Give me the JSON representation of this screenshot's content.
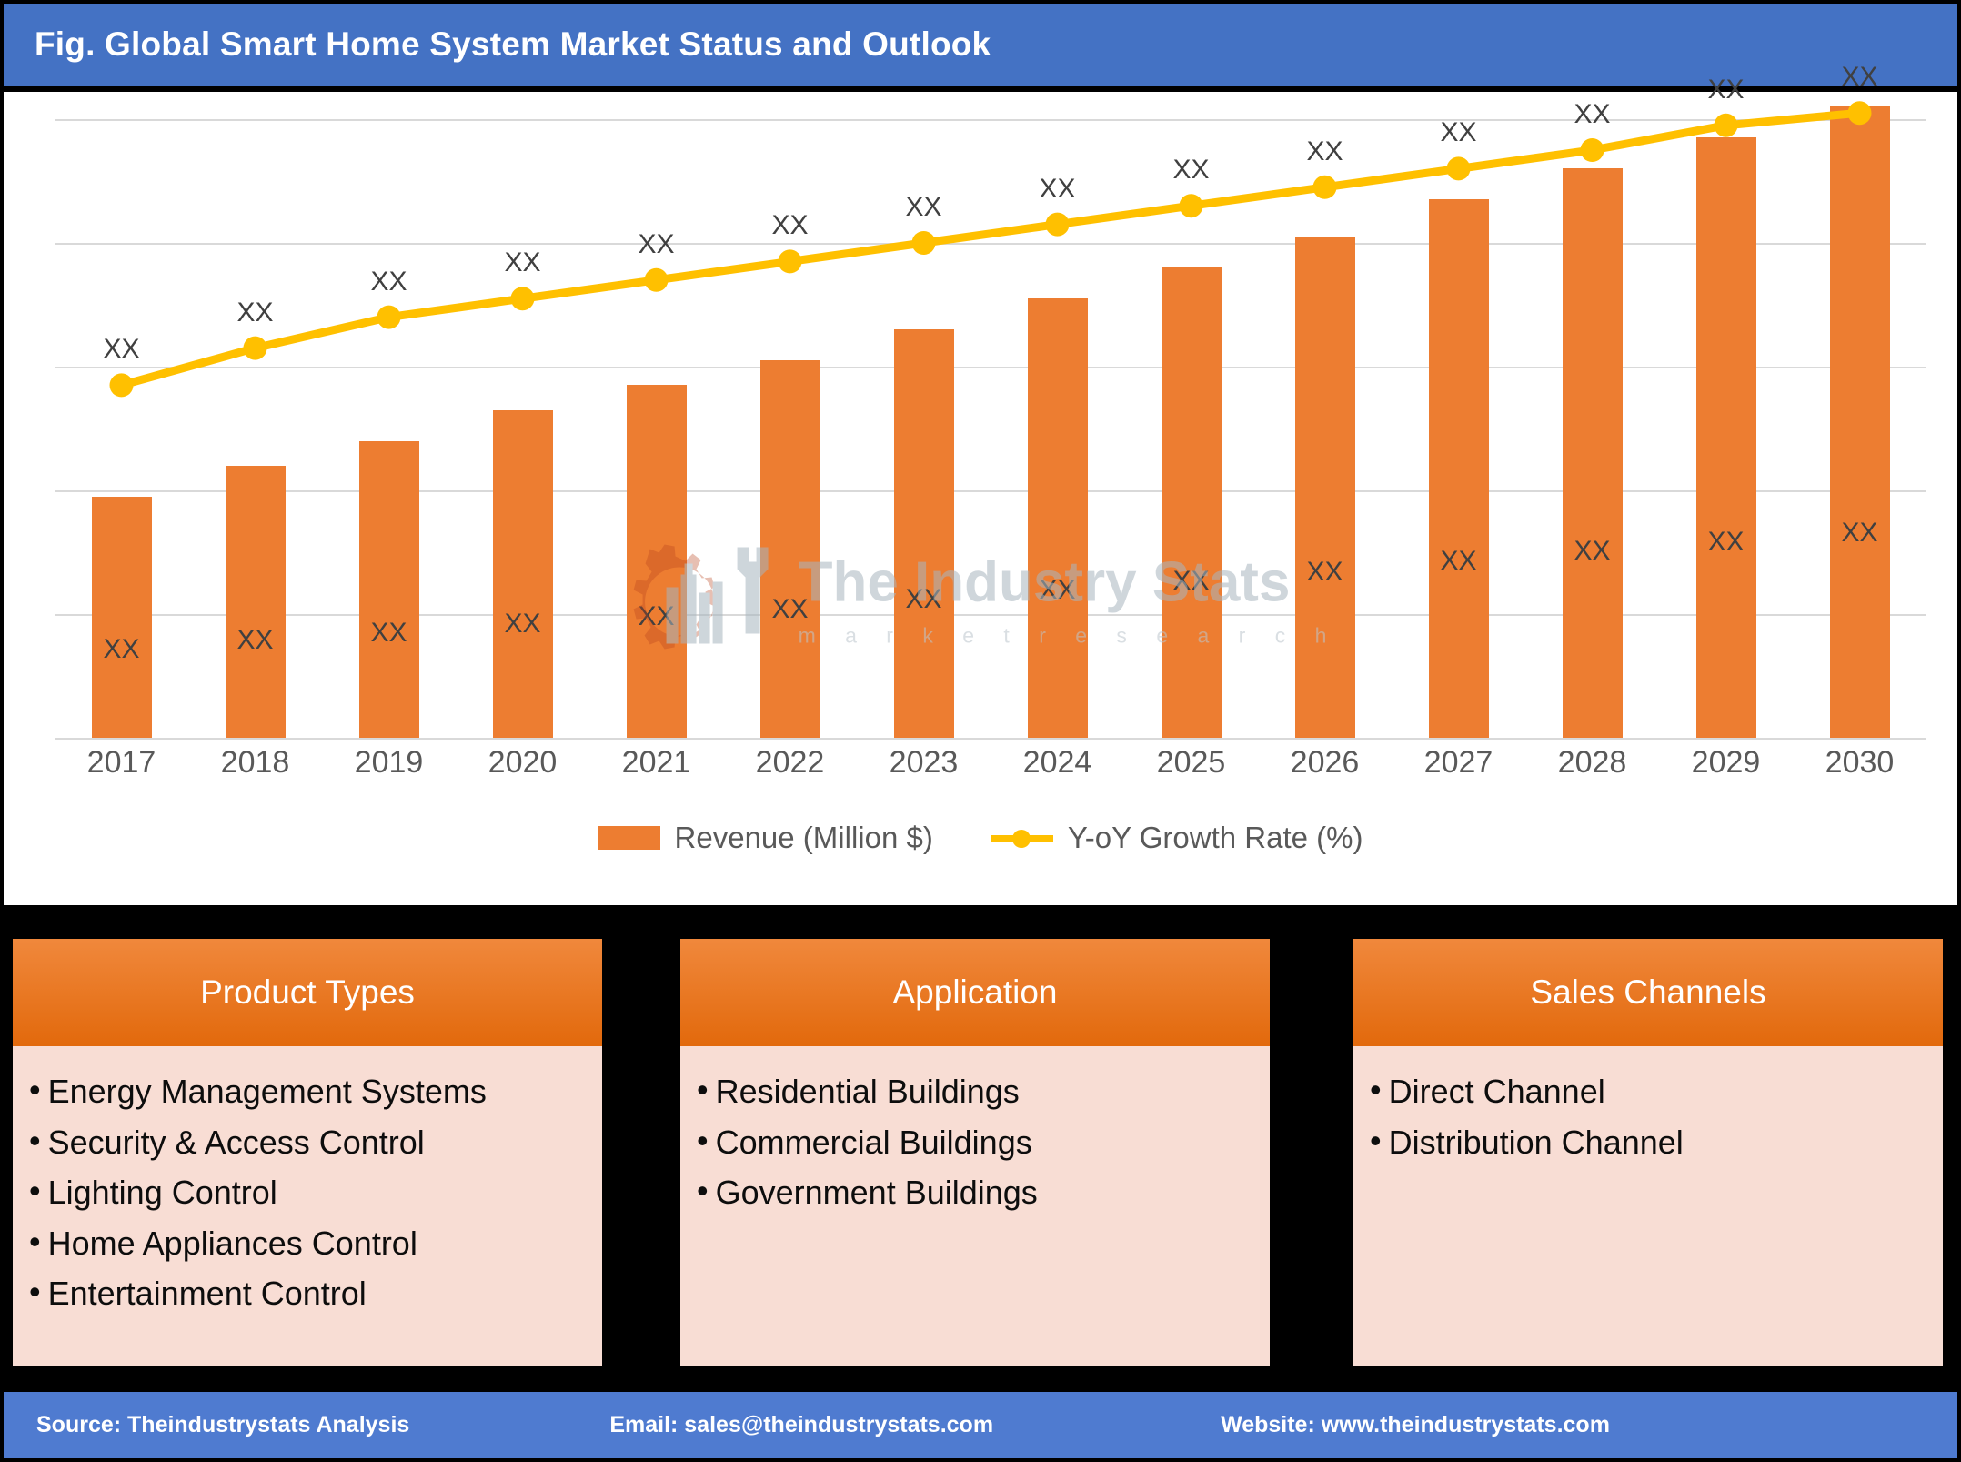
{
  "header": {
    "title": "Fig. Global Smart Home System Market Status and Outlook",
    "background_color": "#4472C4"
  },
  "watermark": {
    "main": "The Industry Stats",
    "sub": "m a r k e t   r e s e a r c h"
  },
  "legend": {
    "items": [
      {
        "label": "Revenue (Million $)",
        "color": "#ED7D31",
        "marker": "square"
      },
      {
        "label": "Y-oY Growth Rate (%)",
        "color": "#FFC000",
        "marker": "line-circle"
      }
    ]
  },
  "chart_data": {
    "type": "bar",
    "title": "Fig. Global Smart Home System Market Status and Outlook",
    "xlabel": "",
    "ylabel": "",
    "grid": true,
    "legend_position": "bottom",
    "categories": [
      "2017",
      "2018",
      "2019",
      "2020",
      "2021",
      "2022",
      "2023",
      "2024",
      "2025",
      "2026",
      "2027",
      "2028",
      "2029",
      "2030"
    ],
    "ylim": [
      0,
      100
    ],
    "series": [
      {
        "name": "Revenue (Million $)",
        "type": "bar",
        "color": "#ED7D31",
        "axis": "left",
        "values": [
          39,
          44,
          48,
          53,
          57,
          61,
          66,
          71,
          76,
          81,
          87,
          92,
          97,
          102
        ],
        "data_labels": [
          "XX",
          "XX",
          "XX",
          "XX",
          "XX",
          "XX",
          "XX",
          "XX",
          "XX",
          "XX",
          "XX",
          "XX",
          "XX",
          "XX"
        ]
      },
      {
        "name": "Y-oY Growth Rate (%)",
        "type": "line",
        "color": "#FFC000",
        "axis": "right",
        "values": [
          57,
          63,
          68,
          71,
          74,
          77,
          80,
          83,
          86,
          89,
          92,
          95,
          99,
          101
        ],
        "data_labels": [
          "XX",
          "XX",
          "XX",
          "XX",
          "XX",
          "XX",
          "XX",
          "XX",
          "XX",
          "XX",
          "XX",
          "XX",
          "XX",
          "XX"
        ]
      }
    ],
    "gridline_levels": [
      100,
      80,
      60,
      40,
      20,
      0
    ]
  },
  "panels": [
    {
      "title": "Product Types",
      "items": [
        "Energy Management Systems",
        "Security & Access Control",
        "Lighting Control",
        "Home Appliances Control",
        "Entertainment Control"
      ]
    },
    {
      "title": "Application",
      "items": [
        "Residential Buildings",
        "Commercial Buildings",
        "Government Buildings"
      ]
    },
    {
      "title": "Sales Channels",
      "items": [
        "Direct Channel",
        "Distribution Channel"
      ]
    }
  ],
  "footer": {
    "source": "Source: Theindustrystats Analysis",
    "email": "Email: sales@theindustrystats.com",
    "website": "Website: www.theindustrystats.com",
    "background_color": "#4F7BD0"
  }
}
